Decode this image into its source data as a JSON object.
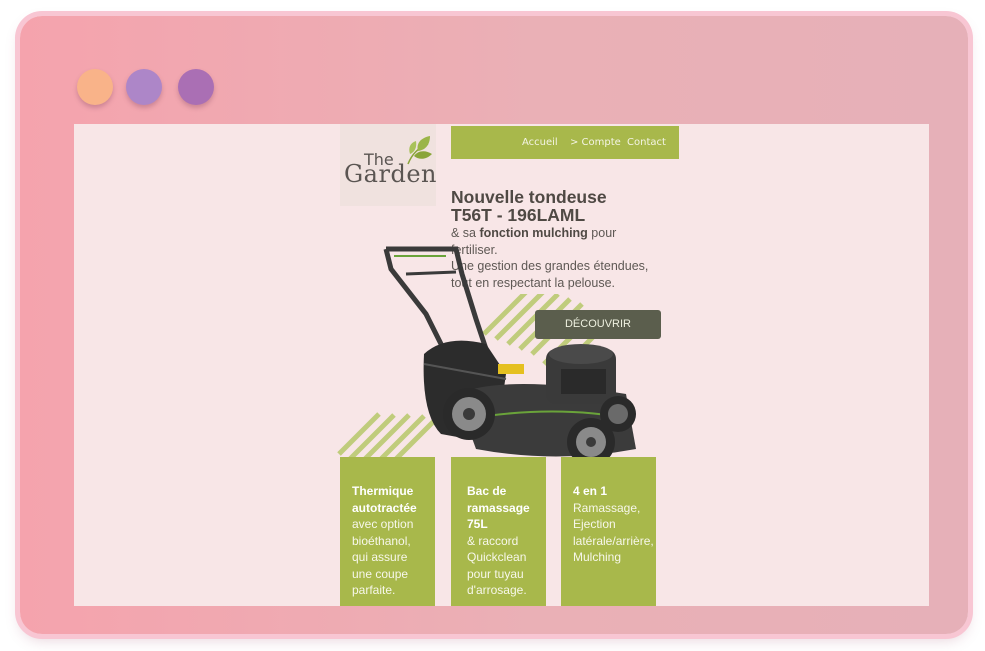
{
  "browser": {
    "dots": [
      {
        "name": "dot-orange",
        "color": "#f9b389"
      },
      {
        "name": "dot-purple",
        "color": "#ad86c8"
      },
      {
        "name": "dot-violet",
        "color": "#aa6fb4"
      }
    ]
  },
  "logo": {
    "the": "The",
    "garden": "Garden",
    "icon": "leaf-icon"
  },
  "nav": {
    "items": [
      "Accueil",
      "> Compte",
      "Contact"
    ]
  },
  "hero": {
    "title_line1": "Nouvelle tondeuse",
    "title_line2": "T56T - 196LAML",
    "text_prefix": "& sa ",
    "text_bold": "fonction mulching",
    "text_suffix": " pour",
    "text_line2": "fertiliser.",
    "text_line3": "Une gestion des grandes étendues,",
    "text_line4": "tout en respectant la pelouse.",
    "cta": "DÉCOUVRIR"
  },
  "features": [
    {
      "title": [
        "Thermique",
        "autotractée"
      ],
      "lines": [
        "avec option",
        "bioéthanol,",
        "qui assure",
        "une coupe",
        "parfaite."
      ]
    },
    {
      "title": [
        "Bac de",
        "ramassage",
        "75L"
      ],
      "lines": [
        "& raccord",
        "Quickclean",
        "pour tuyau",
        "d'arrosage."
      ]
    },
    {
      "title": [
        "4 en 1"
      ],
      "lines": [
        "Ramassage,",
        "Ejection",
        "latérale/arrière,",
        "Mulching"
      ]
    }
  ],
  "colors": {
    "accent_green": "#a8b84b",
    "button_dark": "#5b5e4d",
    "page_bg": "#f8e6e7",
    "frame": "#f5a3ad"
  }
}
